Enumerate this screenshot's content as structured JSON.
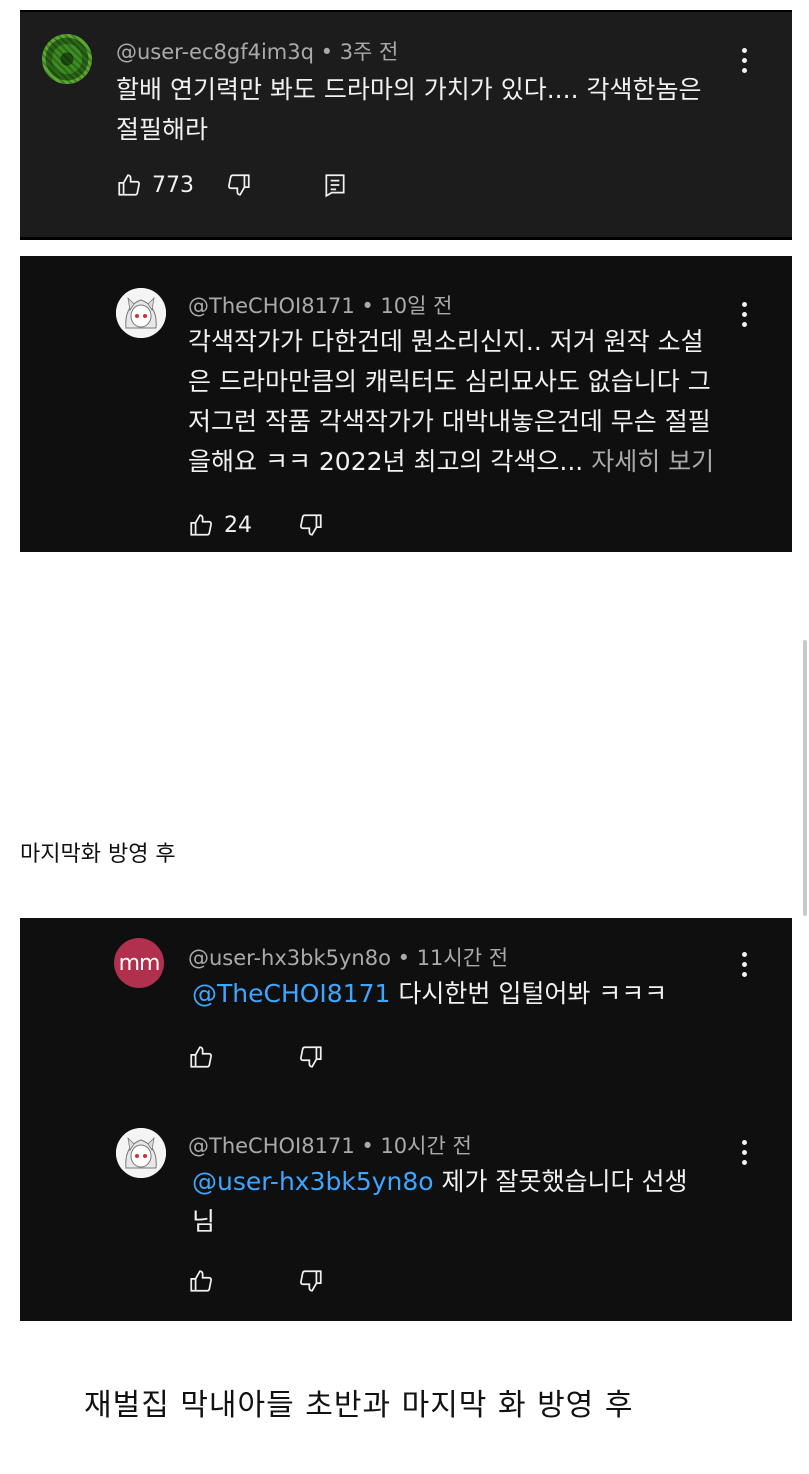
{
  "comments": [
    {
      "author": "@user-ec8gf4im3q",
      "time": "3주 전",
      "lines": [
        "할배 연기력만 봐도 드라마의 가치가 있다.... 각색한놈은",
        "절필해라"
      ],
      "likes": "773"
    },
    {
      "author": "@TheCHOI8171",
      "time": "10일 전",
      "lines": [
        "각색작가가 다한건데 뭔소리신지.. 저거 원작 소설",
        "은 드라마만큼의 캐릭터도 심리묘사도 없습니다 그",
        "저그런 작품 각색작가가 대박내놓은건데 무슨 절필",
        "을해요 ㅋㅋ 2022년 최고의 각색으..."
      ],
      "more_label": "자세히 보기",
      "likes": "24"
    },
    {
      "author": "@user-hx3bk5yn8o",
      "time": "11시간 전",
      "avatar_text": "mm",
      "mention": "@TheCHOI8171",
      "text": "다시한번 입털어봐 ㅋㅋㅋ"
    },
    {
      "author": "@TheCHOI8171",
      "time": "10시간 전",
      "mention": "@user-hx3bk5yn8o",
      "text": "제가 잘못했습니다 선생",
      "text_line2": "님"
    }
  ],
  "caption": "마지막화 방영 후",
  "footer": "재벌집 막내아들 초반과 마지막 화 방영 후",
  "icons": [
    "thumbs-up-icon",
    "thumbs-down-icon",
    "reply-icon",
    "more-vert-icon"
  ],
  "colors": {
    "panel_bg": "#0f0f0f",
    "text": "#f1f1f1",
    "meta": "#aaaaaa",
    "mention": "#3ea6ff"
  }
}
